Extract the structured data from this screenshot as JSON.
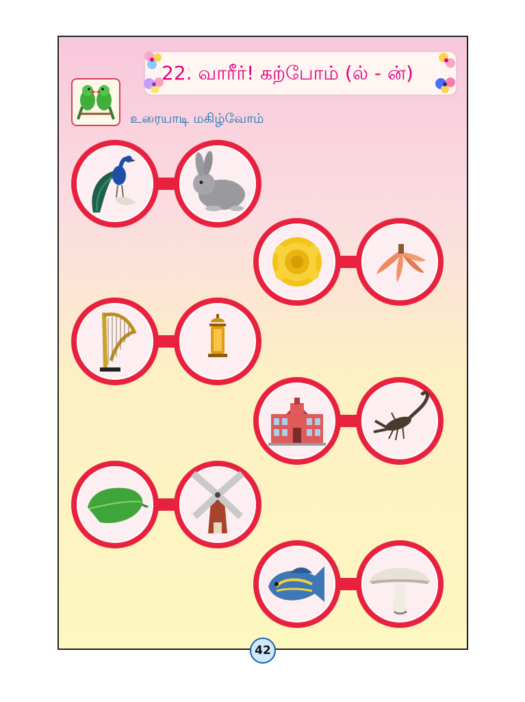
{
  "header": {
    "title": "22. வாரீர்! கற்போம் (ல் - ன்)"
  },
  "section": {
    "subtitle": "உரையாடி மகிழ்வோம்"
  },
  "pairs": [
    {
      "left_icon": "peacock-icon",
      "right_icon": "rabbit-icon"
    },
    {
      "left_icon": "marigold-flower-icon",
      "right_icon": "banana-peel-icon"
    },
    {
      "left_icon": "harp-icon",
      "right_icon": "lantern-icon"
    },
    {
      "left_icon": "school-building-icon",
      "right_icon": "scorpion-icon"
    },
    {
      "left_icon": "leaf-icon",
      "right_icon": "windmill-icon"
    },
    {
      "left_icon": "angelfish-icon",
      "right_icon": "mushroom-icon"
    }
  ],
  "footer": {
    "page_number": "42"
  },
  "colors": {
    "title_pink": "#e4007c",
    "subtitle_blue": "#0b6fb5",
    "circle_red": "#e8213f"
  }
}
